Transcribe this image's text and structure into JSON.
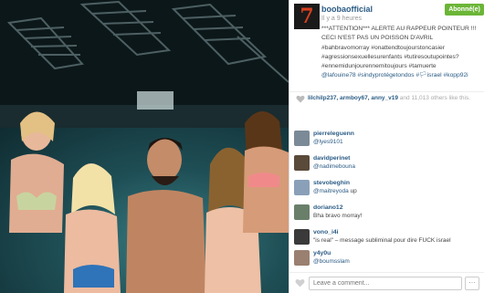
{
  "post": {
    "username": "boobaofficial",
    "timestamp": "Il y a 9 heures",
    "follow_label": "Abonné(e)",
    "caption_lines": [
      "***ATTENTION*** ALERTE AU RAPPEUR POINTEUR !!!",
      "CECI N'EST PAS UN POISSON D'AVRIL",
      "#bahbravomorray #onattendtoujourstoncasier",
      "#agressionsexuellesurenfants #tutiresoutupointes?",
      "#ennemidunjourennemitoujours #tamuerte",
      "@lafouine78 #sindyprotégetondos #🏳israel #kopp92i"
    ],
    "avatar_glyph": "7"
  },
  "likes": {
    "users": "lilchilp237, armboy67, anny_v19",
    "rest": " and 11,013 others like this."
  },
  "comments": [
    {
      "user": "pierreleguenn",
      "text": "@lyes9101",
      "color": "#7a8a96"
    },
    {
      "user": "davidperinet",
      "text": "@nadimebouna",
      "color": "#5a4a3a"
    },
    {
      "user": "stevobeghin",
      "text_mention": "@maitreyoda",
      "text_rest": " up",
      "color": "#8aa0b8"
    },
    {
      "user": "doriano12",
      "text": "Bha bravo morray!",
      "color": "#6a7f6a"
    },
    {
      "user": "vono_i4i",
      "text": "\"is real\" – message subliminal pour dire FUCK israel",
      "color": "#3a3a3a"
    },
    {
      "user": "y4y0u",
      "text": "@boumsslam",
      "color": "#9a8070"
    }
  ],
  "footer": {
    "comment_placeholder": "Leave a comment...",
    "more_label": "···"
  },
  "colors": {
    "accent": "#2a5b84",
    "follow": "#6bb537",
    "heart": "#e0e0e0"
  }
}
